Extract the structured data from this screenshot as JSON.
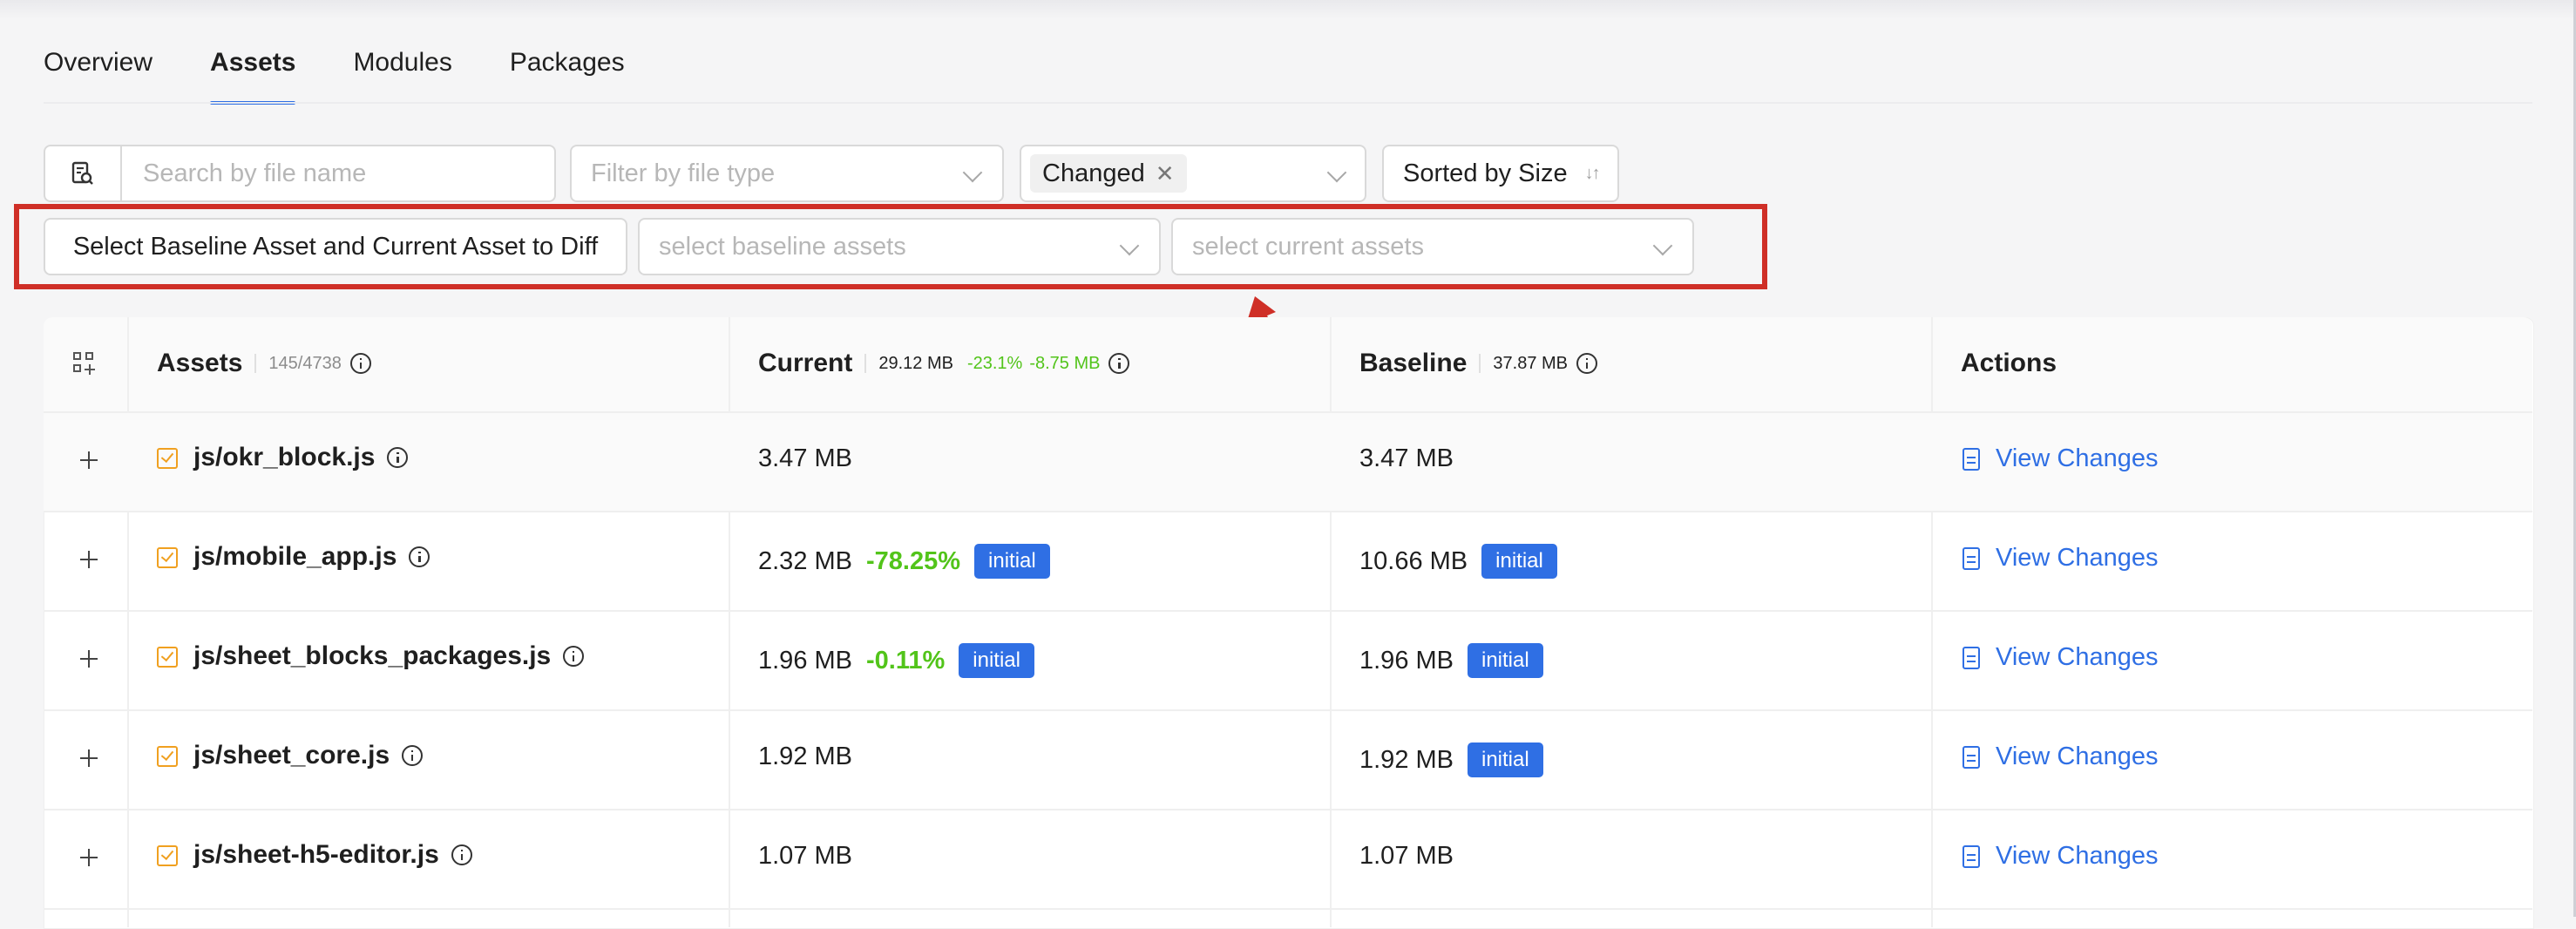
{
  "tabs": [
    "Overview",
    "Assets",
    "Modules",
    "Packages"
  ],
  "filters": {
    "search_placeholder": "Search by file name",
    "file_type_placeholder": "Filter by file type",
    "changed_tag": "Changed",
    "sorted_label": "Sorted by Size"
  },
  "diff": {
    "button_label": "Select Baseline Asset and Current Asset to Diff",
    "baseline_placeholder": "select baseline assets",
    "current_placeholder": "select current assets"
  },
  "table": {
    "assets_header": "Assets",
    "assets_count": "145/4738",
    "current_header": "Current",
    "current_size": "29.12 MB",
    "current_pct": "-23.1%",
    "current_delta": "-8.75 MB",
    "baseline_header": "Baseline",
    "baseline_size": "37.87 MB",
    "actions_header": "Actions",
    "rows": [
      {
        "name": "js/okr_block.js",
        "current": "3.47 MB",
        "pct": "",
        "current_badge": "",
        "baseline": "3.47 MB",
        "baseline_badge": "",
        "action": "View Changes"
      },
      {
        "name": "js/mobile_app.js",
        "current": "2.32 MB",
        "pct": "-78.25%",
        "current_badge": "initial",
        "baseline": "10.66 MB",
        "baseline_badge": "initial",
        "action": "View Changes"
      },
      {
        "name": "js/sheet_blocks_packages.js",
        "current": "1.96 MB",
        "pct": "-0.11%",
        "current_badge": "initial",
        "baseline": "1.96 MB",
        "baseline_badge": "initial",
        "action": "View Changes"
      },
      {
        "name": "js/sheet_core.js",
        "current": "1.92 MB",
        "pct": "",
        "current_badge": "",
        "baseline": "1.92 MB",
        "baseline_badge": "initial",
        "action": "View Changes"
      },
      {
        "name": "js/sheet-h5-editor.js",
        "current": "1.07 MB",
        "pct": "",
        "current_badge": "",
        "baseline": "1.07 MB",
        "baseline_badge": "",
        "action": "View Changes"
      }
    ]
  },
  "colors": {
    "accent": "#2f6fe4",
    "positive": "#52c41a",
    "highlight": "#cf2f27"
  }
}
